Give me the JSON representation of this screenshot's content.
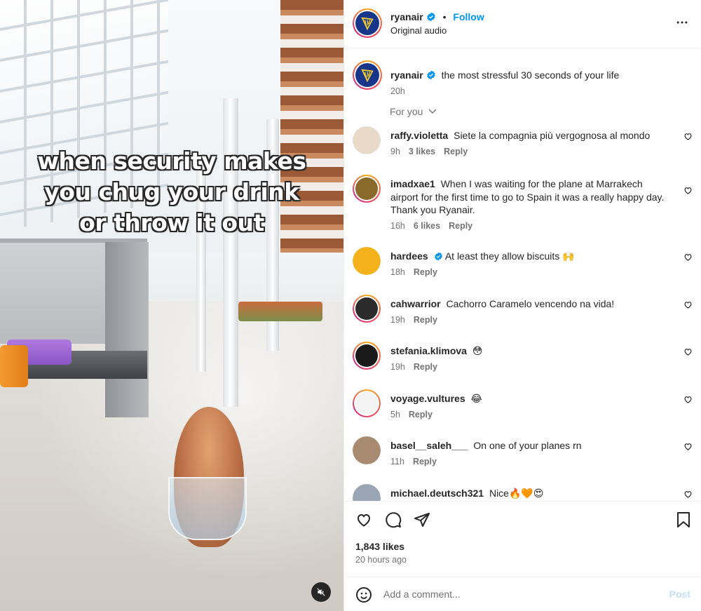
{
  "media": {
    "caption_lines": [
      "when security makes",
      "you chug your drink",
      "or throw it out"
    ],
    "mute_icon": "speaker-muted-icon"
  },
  "header": {
    "username": "ryanair",
    "verified": true,
    "follow_label": "Follow",
    "subtitle": "Original audio",
    "more_icon": "more-horizontal-icon"
  },
  "post_caption": {
    "username": "ryanair",
    "text": "the most stressful 30 seconds of your life",
    "time": "20h"
  },
  "sort": {
    "label": "For you"
  },
  "comments": [
    {
      "username": "raffy.violetta",
      "verified": false,
      "text": "Siete la compagnia più vergognosa al mondo",
      "time": "9h",
      "likes": "3 likes",
      "reply": "Reply",
      "avatar_color": "#e9d9c9",
      "ring": false
    },
    {
      "username": "imadxae1",
      "verified": false,
      "text": "When I was waiting for the plane at Marrakech airport for the first time to go to Spain it was a really happy day. Thank you Ryanair.",
      "time": "16h",
      "likes": "6 likes",
      "reply": "Reply",
      "avatar_color": "#8a6a2a",
      "ring": true
    },
    {
      "username": "hardees",
      "verified": true,
      "text": "At least they allow biscuits 🙌",
      "time": "18h",
      "likes": "",
      "reply": "Reply",
      "avatar_color": "#f6b21c",
      "ring": false
    },
    {
      "username": "cahwarrior",
      "verified": false,
      "text": "Cachorro Caramelo vencendo na vida!",
      "time": "19h",
      "likes": "",
      "reply": "Reply",
      "avatar_color": "#2b2b2b",
      "ring": true
    },
    {
      "username": "stefania.klimova",
      "verified": false,
      "text": "😳",
      "time": "19h",
      "likes": "",
      "reply": "Reply",
      "avatar_color": "#1a1a1a",
      "ring": true
    },
    {
      "username": "voyage.vultures",
      "verified": false,
      "text": "😂",
      "time": "5h",
      "likes": "",
      "reply": "Reply",
      "avatar_color": "#f3f3f3",
      "ring": true
    },
    {
      "username": "basel__saleh___",
      "verified": false,
      "text": "On one of your planes rn",
      "time": "11h",
      "likes": "",
      "reply": "Reply",
      "avatar_color": "#a88a70",
      "ring": false
    },
    {
      "username": "michael.deutsch321",
      "verified": false,
      "text": "Nice🔥🧡😍",
      "time": "",
      "likes": "",
      "reply": "",
      "avatar_color": "#9aa6b5",
      "ring": false
    }
  ],
  "actions": {
    "like_icon": "heart-icon",
    "comment_icon": "comment-icon",
    "share_icon": "send-icon",
    "save_icon": "bookmark-icon"
  },
  "stats": {
    "likes": "1,843 likes",
    "posted": "20 hours ago"
  },
  "composer": {
    "placeholder": "Add a comment...",
    "post_label": "Post",
    "emoji_icon": "emoji-icon"
  },
  "colors": {
    "link": "#0095f6",
    "muted": "#737373",
    "verified": "#0095f6",
    "brand": "#173589"
  }
}
